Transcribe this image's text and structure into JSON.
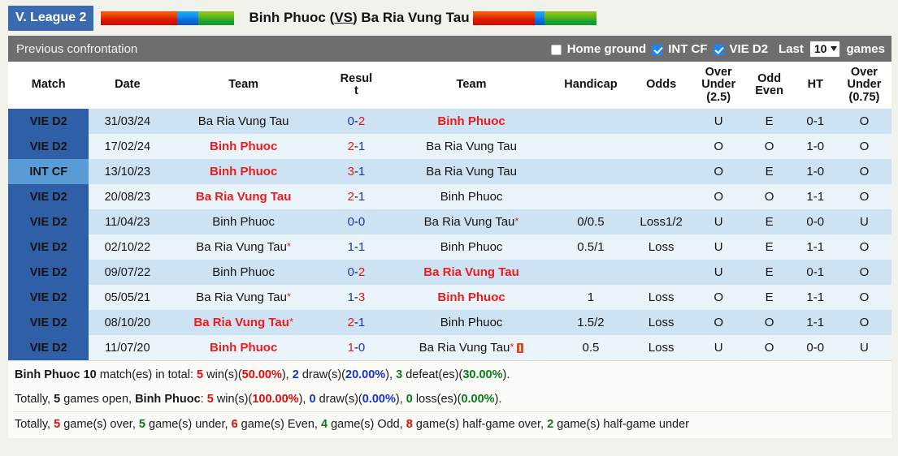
{
  "header": {
    "league_badge": "V. League 2",
    "match_title_home": "Binh Phuoc",
    "match_title_vs_open": "(",
    "match_title_vs": "VS",
    "match_title_vs_close": ")",
    "match_title_away": "Ba Ria Vung Tau",
    "left_bar": {
      "red_pct": 57,
      "blue_pct": 16,
      "green_pct": 27
    },
    "right_bar": {
      "red_pct": 50,
      "blue_pct": 8,
      "green_pct": 42
    },
    "colors": {
      "badge_bg": "#3a6bb0",
      "red": "#db1600",
      "blue": "#0866d8",
      "green": "#16a02f"
    }
  },
  "subbar": {
    "title": "Previous confrontation",
    "home_ground_label": "Home ground",
    "home_ground_checked": false,
    "int_cf_label": "INT CF",
    "int_cf_checked": true,
    "vie_d2_label": "VIE D2",
    "vie_d2_checked": true,
    "last_label": "Last",
    "last_value": "10",
    "games_label": "games"
  },
  "table": {
    "headers": {
      "match": "Match",
      "date": "Date",
      "team_home": "Team",
      "result": "Resul\nt",
      "team_away": "Team",
      "handicap": "Handicap",
      "odds": "Odds",
      "over_under_25": "Over\nUnder\n(2.5)",
      "odd_even": "Odd\nEven",
      "ht": "HT",
      "over_under_075": "Over\nUnder\n(0.75)"
    },
    "rows": [
      {
        "match": "VIE D2",
        "match_alt": false,
        "date": "31/03/24",
        "home": "Ba Ria Vung Tau",
        "home_color": "blk",
        "home_star": false,
        "home_card": false,
        "score_a": "0",
        "score_b": "2",
        "score_a_color": "s-blue",
        "score_b_color": "s-red",
        "away": "Binh Phuoc",
        "away_color": "red",
        "away_star": false,
        "away_card": false,
        "handicap": "",
        "odds": "",
        "ou25": "U",
        "ou25_class": "ou-u",
        "oe": "E",
        "oe_class": "oe-e",
        "ht": "0-1",
        "ou075": "O",
        "ou075_class": "ou-o"
      },
      {
        "match": "VIE D2",
        "match_alt": false,
        "date": "17/02/24",
        "home": "Binh Phuoc",
        "home_color": "red",
        "home_star": false,
        "home_card": false,
        "score_a": "2",
        "score_b": "1",
        "score_a_color": "s-red",
        "score_b_color": "s-blue",
        "away": "Ba Ria Vung Tau",
        "away_color": "blk",
        "away_star": false,
        "away_card": false,
        "handicap": "",
        "odds": "",
        "ou25": "O",
        "ou25_class": "ou-o",
        "oe": "O",
        "oe_class": "oe-o",
        "ht": "1-0",
        "ou075": "O",
        "ou075_class": "ou-o"
      },
      {
        "match": "INT CF",
        "match_alt": true,
        "date": "13/10/23",
        "home": "Binh Phuoc",
        "home_color": "red",
        "home_star": false,
        "home_card": false,
        "score_a": "3",
        "score_b": "1",
        "score_a_color": "s-red",
        "score_b_color": "s-blue",
        "away": "Ba Ria Vung Tau",
        "away_color": "blk",
        "away_star": false,
        "away_card": false,
        "handicap": "",
        "odds": "",
        "ou25": "O",
        "ou25_class": "ou-o",
        "oe": "E",
        "oe_class": "oe-e",
        "ht": "1-0",
        "ou075": "O",
        "ou075_class": "ou-o"
      },
      {
        "match": "VIE D2",
        "match_alt": false,
        "date": "20/08/23",
        "home": "Ba Ria Vung Tau",
        "home_color": "red",
        "home_star": false,
        "home_card": false,
        "score_a": "2",
        "score_b": "1",
        "score_a_color": "s-red",
        "score_b_color": "s-blue",
        "away": "Binh Phuoc",
        "away_color": "blk",
        "away_star": false,
        "away_card": false,
        "handicap": "",
        "odds": "",
        "ou25": "O",
        "ou25_class": "ou-o",
        "oe": "O",
        "oe_class": "oe-o",
        "ht": "1-1",
        "ou075": "O",
        "ou075_class": "ou-o"
      },
      {
        "match": "VIE D2",
        "match_alt": false,
        "date": "11/04/23",
        "home": "Binh Phuoc",
        "home_color": "blk",
        "home_star": false,
        "home_card": false,
        "score_a": "0",
        "score_b": "0",
        "score_a_color": "s-blue",
        "score_b_color": "s-blue",
        "away": "Ba Ria Vung Tau",
        "away_color": "blk",
        "away_star": true,
        "away_card": false,
        "handicap": "0/0.5",
        "odds": "Loss1/2",
        "ou25": "U",
        "ou25_class": "ou-u",
        "oe": "E",
        "oe_class": "oe-e",
        "ht": "0-0",
        "ou075": "U",
        "ou075_class": "ou-u"
      },
      {
        "match": "VIE D2",
        "match_alt": false,
        "date": "02/10/22",
        "home": "Ba Ria Vung Tau",
        "home_color": "blk",
        "home_star": true,
        "home_card": false,
        "score_a": "1",
        "score_b": "1",
        "score_a_color": "s-blue",
        "score_b_color": "s-blue",
        "away": "Binh Phuoc",
        "away_color": "blk",
        "away_star": false,
        "away_card": false,
        "handicap": "0.5/1",
        "odds": "Loss",
        "ou25": "U",
        "ou25_class": "ou-u",
        "oe": "E",
        "oe_class": "oe-e",
        "ht": "1-1",
        "ou075": "O",
        "ou075_class": "ou-o"
      },
      {
        "match": "VIE D2",
        "match_alt": false,
        "date": "09/07/22",
        "home": "Binh Phuoc",
        "home_color": "blk",
        "home_star": false,
        "home_card": false,
        "score_a": "0",
        "score_b": "2",
        "score_a_color": "s-blue",
        "score_b_color": "s-red",
        "away": "Ba Ria Vung Tau",
        "away_color": "red",
        "away_star": false,
        "away_card": false,
        "handicap": "",
        "odds": "",
        "ou25": "U",
        "ou25_class": "ou-u",
        "oe": "E",
        "oe_class": "oe-e",
        "ht": "0-1",
        "ou075": "O",
        "ou075_class": "ou-o"
      },
      {
        "match": "VIE D2",
        "match_alt": false,
        "date": "05/05/21",
        "home": "Ba Ria Vung Tau",
        "home_color": "blk",
        "home_star": true,
        "home_card": false,
        "score_a": "1",
        "score_b": "3",
        "score_a_color": "s-blue",
        "score_b_color": "s-red",
        "away": "Binh Phuoc",
        "away_color": "red",
        "away_star": false,
        "away_card": false,
        "handicap": "1",
        "odds": "Loss",
        "ou25": "O",
        "ou25_class": "ou-o",
        "oe": "E",
        "oe_class": "oe-e",
        "ht": "1-1",
        "ou075": "O",
        "ou075_class": "ou-o"
      },
      {
        "match": "VIE D2",
        "match_alt": false,
        "date": "08/10/20",
        "home": "Ba Ria Vung Tau",
        "home_color": "red",
        "home_star": true,
        "home_card": false,
        "score_a": "2",
        "score_b": "1",
        "score_a_color": "s-red",
        "score_b_color": "s-blue",
        "away": "Binh Phuoc",
        "away_color": "blk",
        "away_star": false,
        "away_card": false,
        "handicap": "1.5/2",
        "odds": "Loss",
        "ou25": "O",
        "ou25_class": "ou-o",
        "oe": "O",
        "oe_class": "oe-o",
        "ht": "1-1",
        "ou075": "O",
        "ou075_class": "ou-o"
      },
      {
        "match": "VIE D2",
        "match_alt": false,
        "date": "11/07/20",
        "home": "Binh Phuoc",
        "home_color": "red",
        "home_star": false,
        "home_card": false,
        "score_a": "1",
        "score_b": "0",
        "score_a_color": "s-red",
        "score_b_color": "s-blue",
        "away": "Ba Ria Vung Tau",
        "away_color": "blk",
        "away_star": true,
        "away_card": true,
        "handicap": "0.5",
        "odds": "Loss",
        "ou25": "U",
        "ou25_class": "ou-u",
        "oe": "O",
        "oe_class": "oe-o",
        "ht": "0-0",
        "ou075": "U",
        "ou075_class": "ou-u"
      }
    ]
  },
  "summary": {
    "line1": {
      "team": "Binh Phuoc",
      "total": "10",
      "total_suffix": "match(es) in total:",
      "wins": "5",
      "wins_label": "win(s)(",
      "wins_pct": "50.00%",
      "wins_close": "),",
      "draws": "2",
      "draws_label": "draw(s)(",
      "draws_pct": "20.00%",
      "draws_close": "),",
      "defeats": "3",
      "defeats_label": "defeat(es)(",
      "defeats_pct": "30.00%",
      "defeats_close": ")."
    },
    "line2": {
      "prefix": "Totally,",
      "open_games": "5",
      "open_label": "games open,",
      "team": "Binh Phuoc",
      "colon": ":",
      "wins": "5",
      "wins_label": "win(s)(",
      "wins_pct": "100.00%",
      "wins_close": "),",
      "draws": "0",
      "draws_label": "draw(s)(",
      "draws_pct": "0.00%",
      "draws_close": "),",
      "losses": "0",
      "losses_label": "loss(es)(",
      "losses_pct": "0.00%",
      "losses_close": ")."
    },
    "line3": {
      "prefix": "Totally,",
      "over": "5",
      "over_label": "game(s) over,",
      "under": "5",
      "under_label": "game(s) under,",
      "even": "6",
      "even_label": "game(s) Even,",
      "odd": "4",
      "odd_label": "game(s) Odd,",
      "hg_over": "8",
      "hg_over_label": "game(s) half-game over,",
      "hg_under": "2",
      "hg_under_label": "game(s) half-game under"
    }
  }
}
